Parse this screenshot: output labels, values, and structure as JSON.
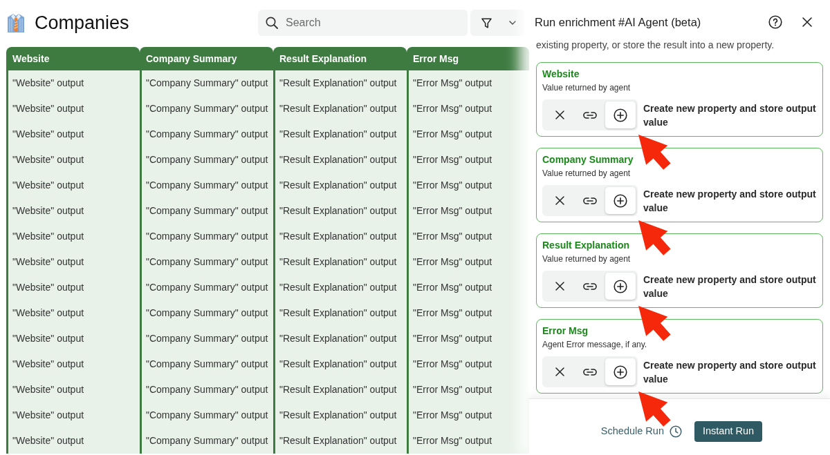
{
  "page": {
    "title": "Companies"
  },
  "search": {
    "placeholder": "Search"
  },
  "table": {
    "columns": [
      "Website",
      "Company Summary",
      "Result Explanation",
      "Error Msg"
    ],
    "rows": [
      [
        "\"Website\" output",
        "\"Company Summary\" output",
        "\"Result Explanation\" output",
        "\"Error Msg\" output"
      ],
      [
        "\"Website\" output",
        "\"Company Summary\" output",
        "\"Result Explanation\" output",
        "\"Error Msg\" output"
      ],
      [
        "\"Website\" output",
        "\"Company Summary\" output",
        "\"Result Explanation\" output",
        "\"Error Msg\" output"
      ],
      [
        "\"Website\" output",
        "\"Company Summary\" output",
        "\"Result Explanation\" output",
        "\"Error Msg\" output"
      ],
      [
        "\"Website\" output",
        "\"Company Summary\" output",
        "\"Result Explanation\" output",
        "\"Error Msg\" output"
      ],
      [
        "\"Website\" output",
        "\"Company Summary\" output",
        "\"Result Explanation\" output",
        "\"Error Msg\" output"
      ],
      [
        "\"Website\" output",
        "\"Company Summary\" output",
        "\"Result Explanation\" output",
        "\"Error Msg\" output"
      ],
      [
        "\"Website\" output",
        "\"Company Summary\" output",
        "\"Result Explanation\" output",
        "\"Error Msg\" output"
      ],
      [
        "\"Website\" output",
        "\"Company Summary\" output",
        "\"Result Explanation\" output",
        "\"Error Msg\" output"
      ],
      [
        "\"Website\" output",
        "\"Company Summary\" output",
        "\"Result Explanation\" output",
        "\"Error Msg\" output"
      ],
      [
        "\"Website\" output",
        "\"Company Summary\" output",
        "\"Result Explanation\" output",
        "\"Error Msg\" output"
      ],
      [
        "\"Website\" output",
        "\"Company Summary\" output",
        "\"Result Explanation\" output",
        "\"Error Msg\" output"
      ],
      [
        "\"Website\" output",
        "\"Company Summary\" output",
        "\"Result Explanation\" output",
        "\"Error Msg\" output"
      ],
      [
        "\"Website\" output",
        "\"Company Summary\" output",
        "\"Result Explanation\" output",
        "\"Error Msg\" output"
      ],
      [
        "\"Website\" output",
        "\"Company Summary\" output",
        "\"Result Explanation\" output",
        "\"Error Msg\" output"
      ]
    ]
  },
  "panel": {
    "title": "Run enrichment #AI Agent (beta)",
    "description": "existing property, or store the result into a new property.",
    "outputs": [
      {
        "name": "Website",
        "description": "Value returned by agent",
        "options": [
          {
            "kind": "remove",
            "selected": false
          },
          {
            "kind": "link",
            "selected": false
          },
          {
            "kind": "create",
            "selected": true
          }
        ],
        "action_label": "Create new property and store output value"
      },
      {
        "name": "Company Summary",
        "description": "Value returned by agent",
        "options": [
          {
            "kind": "remove",
            "selected": false
          },
          {
            "kind": "link",
            "selected": false
          },
          {
            "kind": "create",
            "selected": true
          }
        ],
        "action_label": "Create new property and store output value"
      },
      {
        "name": "Result Explanation",
        "description": "Value returned by agent",
        "options": [
          {
            "kind": "remove",
            "selected": false
          },
          {
            "kind": "link",
            "selected": false
          },
          {
            "kind": "create",
            "selected": true
          }
        ],
        "action_label": "Create new property and store output value"
      },
      {
        "name": "Error Msg",
        "description": "Agent Error message, if any.",
        "options": [
          {
            "kind": "remove",
            "selected": false
          },
          {
            "kind": "link",
            "selected": false
          },
          {
            "kind": "create",
            "selected": true
          }
        ],
        "action_label": "Create new property and store output value"
      }
    ],
    "schedule_label": "Schedule Run",
    "run_button": "Instant Run"
  }
}
